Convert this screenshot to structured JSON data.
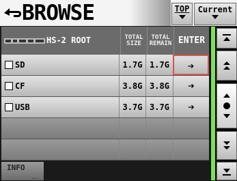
{
  "header": {
    "title": "BROWSE",
    "top_label": "TOP",
    "current_label": "Current"
  },
  "columns": {
    "name": "HS-2 ROOT",
    "total_size_line1": "TOTAL",
    "total_size_line2": "SIZE",
    "total_remain_line1": "TOTAL",
    "total_remain_line2": "REMAIN",
    "enter": "ENTER"
  },
  "rows": [
    {
      "icon": "sd-card-icon",
      "name": "SD",
      "total_size": "1.7G",
      "total_remain": "1.7G",
      "enter": "➔"
    },
    {
      "icon": "cf-card-icon",
      "name": "CF",
      "total_size": "3.8G",
      "total_remain": "3.8G",
      "enter": "➔"
    },
    {
      "icon": "usb-drive-icon",
      "name": "USB",
      "total_size": "3.7G",
      "total_remain": "3.7G",
      "enter": "➔"
    }
  ],
  "footer": {
    "info_label": "INFO",
    "info_dots": "..."
  },
  "colors": {
    "accent_green": "#7ee05a",
    "focus_red": "#d9534f"
  }
}
